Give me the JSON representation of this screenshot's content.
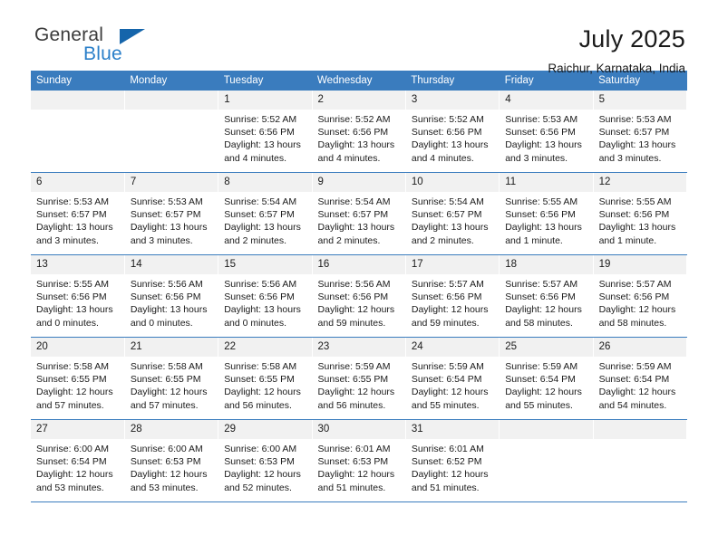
{
  "brand": {
    "line1": "General",
    "line2": "Blue",
    "flag_icon": "triangle-flag-icon"
  },
  "header": {
    "title": "July 2025",
    "subtitle": "Raichur, Karnataka, India"
  },
  "calendar": {
    "weekday_headers": [
      "Sunday",
      "Monday",
      "Tuesday",
      "Wednesday",
      "Thursday",
      "Friday",
      "Saturday"
    ],
    "labels": {
      "sunrise_prefix": "Sunrise:",
      "sunset_prefix": "Sunset:",
      "daylight_prefix": "Daylight:"
    },
    "colors": {
      "header_blue": "#3a7cbe",
      "brand_blue": "#2a7fc9",
      "daynum_band": "#f1f1f1",
      "rule_blue": "#3a7cbe"
    },
    "weeks": [
      [
        {
          "day": "",
          "empty": true
        },
        {
          "day": "",
          "empty": true
        },
        {
          "day": "1",
          "sunrise": "Sunrise: 5:52 AM",
          "sunset": "Sunset: 6:56 PM",
          "daylight": "Daylight: 13 hours and 4 minutes."
        },
        {
          "day": "2",
          "sunrise": "Sunrise: 5:52 AM",
          "sunset": "Sunset: 6:56 PM",
          "daylight": "Daylight: 13 hours and 4 minutes."
        },
        {
          "day": "3",
          "sunrise": "Sunrise: 5:52 AM",
          "sunset": "Sunset: 6:56 PM",
          "daylight": "Daylight: 13 hours and 4 minutes."
        },
        {
          "day": "4",
          "sunrise": "Sunrise: 5:53 AM",
          "sunset": "Sunset: 6:56 PM",
          "daylight": "Daylight: 13 hours and 3 minutes."
        },
        {
          "day": "5",
          "sunrise": "Sunrise: 5:53 AM",
          "sunset": "Sunset: 6:57 PM",
          "daylight": "Daylight: 13 hours and 3 minutes."
        }
      ],
      [
        {
          "day": "6",
          "sunrise": "Sunrise: 5:53 AM",
          "sunset": "Sunset: 6:57 PM",
          "daylight": "Daylight: 13 hours and 3 minutes."
        },
        {
          "day": "7",
          "sunrise": "Sunrise: 5:53 AM",
          "sunset": "Sunset: 6:57 PM",
          "daylight": "Daylight: 13 hours and 3 minutes."
        },
        {
          "day": "8",
          "sunrise": "Sunrise: 5:54 AM",
          "sunset": "Sunset: 6:57 PM",
          "daylight": "Daylight: 13 hours and 2 minutes."
        },
        {
          "day": "9",
          "sunrise": "Sunrise: 5:54 AM",
          "sunset": "Sunset: 6:57 PM",
          "daylight": "Daylight: 13 hours and 2 minutes."
        },
        {
          "day": "10",
          "sunrise": "Sunrise: 5:54 AM",
          "sunset": "Sunset: 6:57 PM",
          "daylight": "Daylight: 13 hours and 2 minutes."
        },
        {
          "day": "11",
          "sunrise": "Sunrise: 5:55 AM",
          "sunset": "Sunset: 6:56 PM",
          "daylight": "Daylight: 13 hours and 1 minute."
        },
        {
          "day": "12",
          "sunrise": "Sunrise: 5:55 AM",
          "sunset": "Sunset: 6:56 PM",
          "daylight": "Daylight: 13 hours and 1 minute."
        }
      ],
      [
        {
          "day": "13",
          "sunrise": "Sunrise: 5:55 AM",
          "sunset": "Sunset: 6:56 PM",
          "daylight": "Daylight: 13 hours and 0 minutes."
        },
        {
          "day": "14",
          "sunrise": "Sunrise: 5:56 AM",
          "sunset": "Sunset: 6:56 PM",
          "daylight": "Daylight: 13 hours and 0 minutes."
        },
        {
          "day": "15",
          "sunrise": "Sunrise: 5:56 AM",
          "sunset": "Sunset: 6:56 PM",
          "daylight": "Daylight: 13 hours and 0 minutes."
        },
        {
          "day": "16",
          "sunrise": "Sunrise: 5:56 AM",
          "sunset": "Sunset: 6:56 PM",
          "daylight": "Daylight: 12 hours and 59 minutes."
        },
        {
          "day": "17",
          "sunrise": "Sunrise: 5:57 AM",
          "sunset": "Sunset: 6:56 PM",
          "daylight": "Daylight: 12 hours and 59 minutes."
        },
        {
          "day": "18",
          "sunrise": "Sunrise: 5:57 AM",
          "sunset": "Sunset: 6:56 PM",
          "daylight": "Daylight: 12 hours and 58 minutes."
        },
        {
          "day": "19",
          "sunrise": "Sunrise: 5:57 AM",
          "sunset": "Sunset: 6:56 PM",
          "daylight": "Daylight: 12 hours and 58 minutes."
        }
      ],
      [
        {
          "day": "20",
          "sunrise": "Sunrise: 5:58 AM",
          "sunset": "Sunset: 6:55 PM",
          "daylight": "Daylight: 12 hours and 57 minutes."
        },
        {
          "day": "21",
          "sunrise": "Sunrise: 5:58 AM",
          "sunset": "Sunset: 6:55 PM",
          "daylight": "Daylight: 12 hours and 57 minutes."
        },
        {
          "day": "22",
          "sunrise": "Sunrise: 5:58 AM",
          "sunset": "Sunset: 6:55 PM",
          "daylight": "Daylight: 12 hours and 56 minutes."
        },
        {
          "day": "23",
          "sunrise": "Sunrise: 5:59 AM",
          "sunset": "Sunset: 6:55 PM",
          "daylight": "Daylight: 12 hours and 56 minutes."
        },
        {
          "day": "24",
          "sunrise": "Sunrise: 5:59 AM",
          "sunset": "Sunset: 6:54 PM",
          "daylight": "Daylight: 12 hours and 55 minutes."
        },
        {
          "day": "25",
          "sunrise": "Sunrise: 5:59 AM",
          "sunset": "Sunset: 6:54 PM",
          "daylight": "Daylight: 12 hours and 55 minutes."
        },
        {
          "day": "26",
          "sunrise": "Sunrise: 5:59 AM",
          "sunset": "Sunset: 6:54 PM",
          "daylight": "Daylight: 12 hours and 54 minutes."
        }
      ],
      [
        {
          "day": "27",
          "sunrise": "Sunrise: 6:00 AM",
          "sunset": "Sunset: 6:54 PM",
          "daylight": "Daylight: 12 hours and 53 minutes."
        },
        {
          "day": "28",
          "sunrise": "Sunrise: 6:00 AM",
          "sunset": "Sunset: 6:53 PM",
          "daylight": "Daylight: 12 hours and 53 minutes."
        },
        {
          "day": "29",
          "sunrise": "Sunrise: 6:00 AM",
          "sunset": "Sunset: 6:53 PM",
          "daylight": "Daylight: 12 hours and 52 minutes."
        },
        {
          "day": "30",
          "sunrise": "Sunrise: 6:01 AM",
          "sunset": "Sunset: 6:53 PM",
          "daylight": "Daylight: 12 hours and 51 minutes."
        },
        {
          "day": "31",
          "sunrise": "Sunrise: 6:01 AM",
          "sunset": "Sunset: 6:52 PM",
          "daylight": "Daylight: 12 hours and 51 minutes."
        },
        {
          "day": "",
          "empty": true
        },
        {
          "day": "",
          "empty": true
        }
      ]
    ]
  }
}
